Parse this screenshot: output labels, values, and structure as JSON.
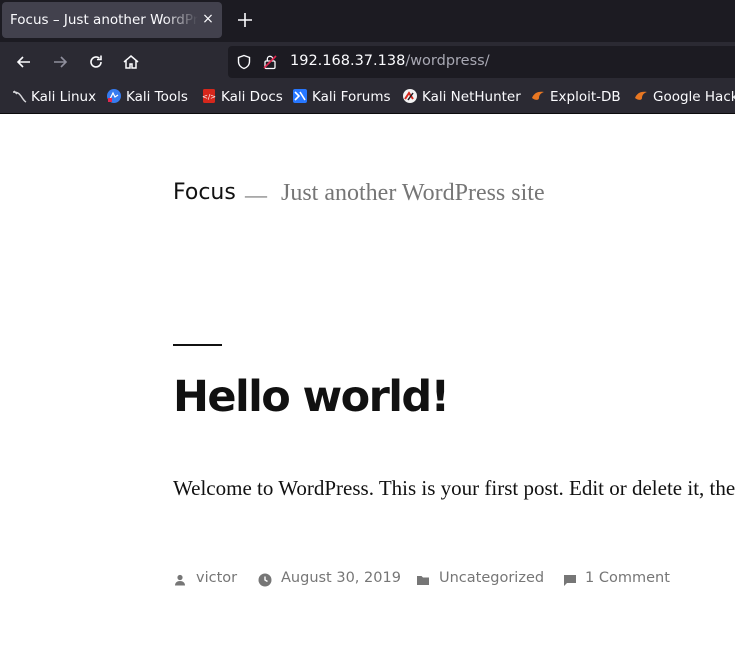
{
  "browser": {
    "tab": {
      "title": "Focus – Just another WordPress site",
      "close_glyph": "×"
    },
    "new_tab_icon": "plus-icon",
    "nav": {
      "back_icon": "arrow-left-icon",
      "forward_icon": "arrow-right-icon",
      "reload_icon": "reload-icon",
      "home_icon": "home-icon"
    },
    "url": {
      "host": "192.168.37.138",
      "path": "/wordpress/"
    },
    "bookmarks": [
      {
        "label": "Kali Linux",
        "icon": "kali-dragon-icon"
      },
      {
        "label": "Kali Tools",
        "icon": "kali-tools-icon"
      },
      {
        "label": "Kali Docs",
        "icon": "kali-docs-icon"
      },
      {
        "label": "Kali Forums",
        "icon": "kali-forums-icon"
      },
      {
        "label": "Kali NetHunter",
        "icon": "nethunter-icon"
      },
      {
        "label": "Exploit-DB",
        "icon": "exploit-db-icon"
      },
      {
        "label": "Google Hacking DB",
        "icon": "ghdb-icon"
      }
    ]
  },
  "site": {
    "title": "Focus",
    "separator": "—",
    "description": "Just another WordPress site"
  },
  "post": {
    "title": "Hello world!",
    "excerpt": "Welcome to WordPress. This is your first post. Edit or delete it, then start writing!",
    "meta": {
      "author": "victor",
      "date": "August 30, 2019",
      "category": "Uncategorized",
      "comments": "1 Comment"
    }
  },
  "colors": {
    "tabbar": "#1c1b22",
    "toolbar": "#2b2a33",
    "text": "#111111",
    "muted": "#767676"
  }
}
